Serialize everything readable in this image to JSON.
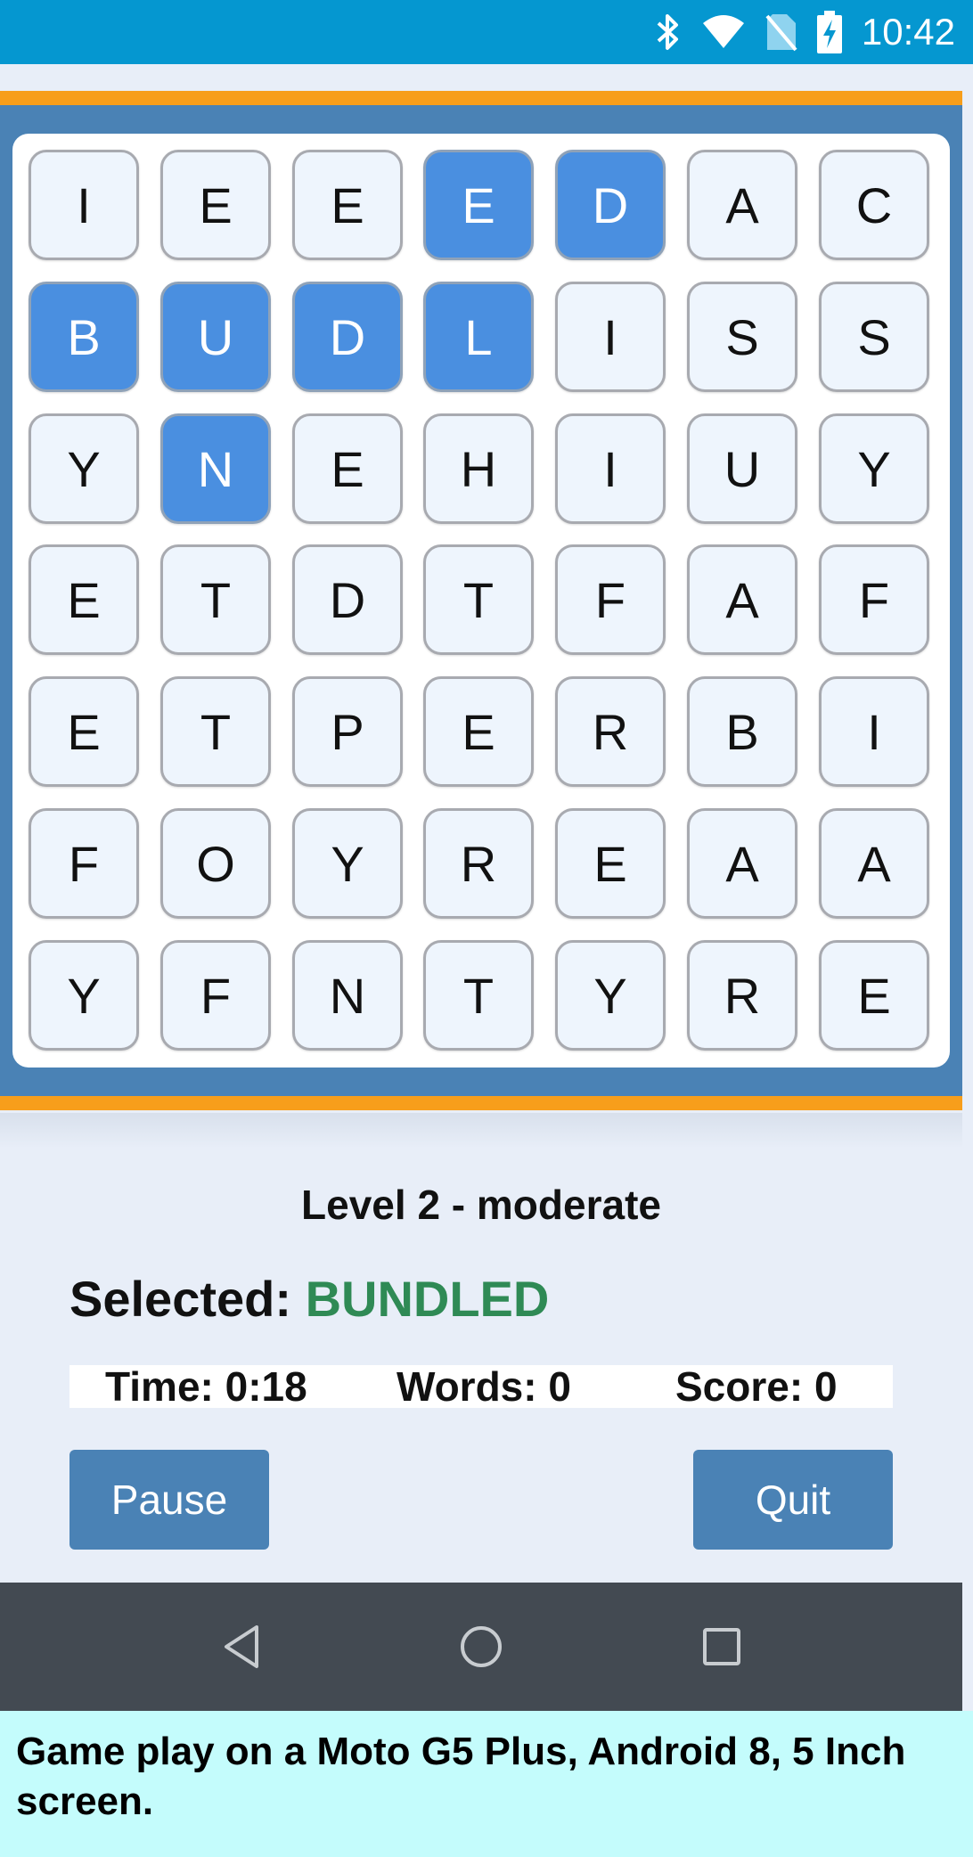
{
  "status_bar": {
    "time": "10:42",
    "icons": [
      "bluetooth-icon",
      "wifi-icon",
      "no-sim-icon",
      "battery-charging-icon"
    ]
  },
  "grid": {
    "rows": [
      [
        {
          "letter": "I",
          "selected": false
        },
        {
          "letter": "E",
          "selected": false
        },
        {
          "letter": "E",
          "selected": false
        },
        {
          "letter": "E",
          "selected": true
        },
        {
          "letter": "D",
          "selected": true
        },
        {
          "letter": "A",
          "selected": false
        },
        {
          "letter": "C",
          "selected": false
        }
      ],
      [
        {
          "letter": "B",
          "selected": true
        },
        {
          "letter": "U",
          "selected": true
        },
        {
          "letter": "D",
          "selected": true
        },
        {
          "letter": "L",
          "selected": true
        },
        {
          "letter": "I",
          "selected": false
        },
        {
          "letter": "S",
          "selected": false
        },
        {
          "letter": "S",
          "selected": false
        }
      ],
      [
        {
          "letter": "Y",
          "selected": false
        },
        {
          "letter": "N",
          "selected": true
        },
        {
          "letter": "E",
          "selected": false
        },
        {
          "letter": "H",
          "selected": false
        },
        {
          "letter": "I",
          "selected": false
        },
        {
          "letter": "U",
          "selected": false
        },
        {
          "letter": "Y",
          "selected": false
        }
      ],
      [
        {
          "letter": "E",
          "selected": false
        },
        {
          "letter": "T",
          "selected": false
        },
        {
          "letter": "D",
          "selected": false
        },
        {
          "letter": "T",
          "selected": false
        },
        {
          "letter": "F",
          "selected": false
        },
        {
          "letter": "A",
          "selected": false
        },
        {
          "letter": "F",
          "selected": false
        }
      ],
      [
        {
          "letter": "E",
          "selected": false
        },
        {
          "letter": "T",
          "selected": false
        },
        {
          "letter": "P",
          "selected": false
        },
        {
          "letter": "E",
          "selected": false
        },
        {
          "letter": "R",
          "selected": false
        },
        {
          "letter": "B",
          "selected": false
        },
        {
          "letter": "I",
          "selected": false
        }
      ],
      [
        {
          "letter": "F",
          "selected": false
        },
        {
          "letter": "O",
          "selected": false
        },
        {
          "letter": "Y",
          "selected": false
        },
        {
          "letter": "R",
          "selected": false
        },
        {
          "letter": "E",
          "selected": false
        },
        {
          "letter": "A",
          "selected": false
        },
        {
          "letter": "A",
          "selected": false
        }
      ],
      [
        {
          "letter": "Y",
          "selected": false
        },
        {
          "letter": "F",
          "selected": false
        },
        {
          "letter": "N",
          "selected": false
        },
        {
          "letter": "T",
          "selected": false
        },
        {
          "letter": "Y",
          "selected": false
        },
        {
          "letter": "R",
          "selected": false
        },
        {
          "letter": "E",
          "selected": false
        }
      ]
    ]
  },
  "level_text": "Level 2 - moderate",
  "selected": {
    "label": "Selected:",
    "word": "BUNDLED"
  },
  "stats": {
    "time": "Time: 0:18",
    "words": "Words: 0",
    "score": "Score: 0"
  },
  "buttons": {
    "pause": "Pause",
    "quit": "Quit"
  },
  "nav": {
    "icons": [
      "back-icon",
      "home-icon",
      "recents-icon"
    ]
  },
  "caption": "Game play on a Moto G5 Plus, Android 8, 5 Inch screen.",
  "colors": {
    "status_bar": "#0597d0",
    "accent_orange": "#f79e1b",
    "board_frame": "#4a82b5",
    "tile_selected": "#4a8fe0",
    "tile_normal": "#eef5fd",
    "selected_word": "#2f8a55",
    "button": "#4a82b5",
    "nav_bar": "#434a52",
    "caption_bg": "#c4fcfc"
  }
}
